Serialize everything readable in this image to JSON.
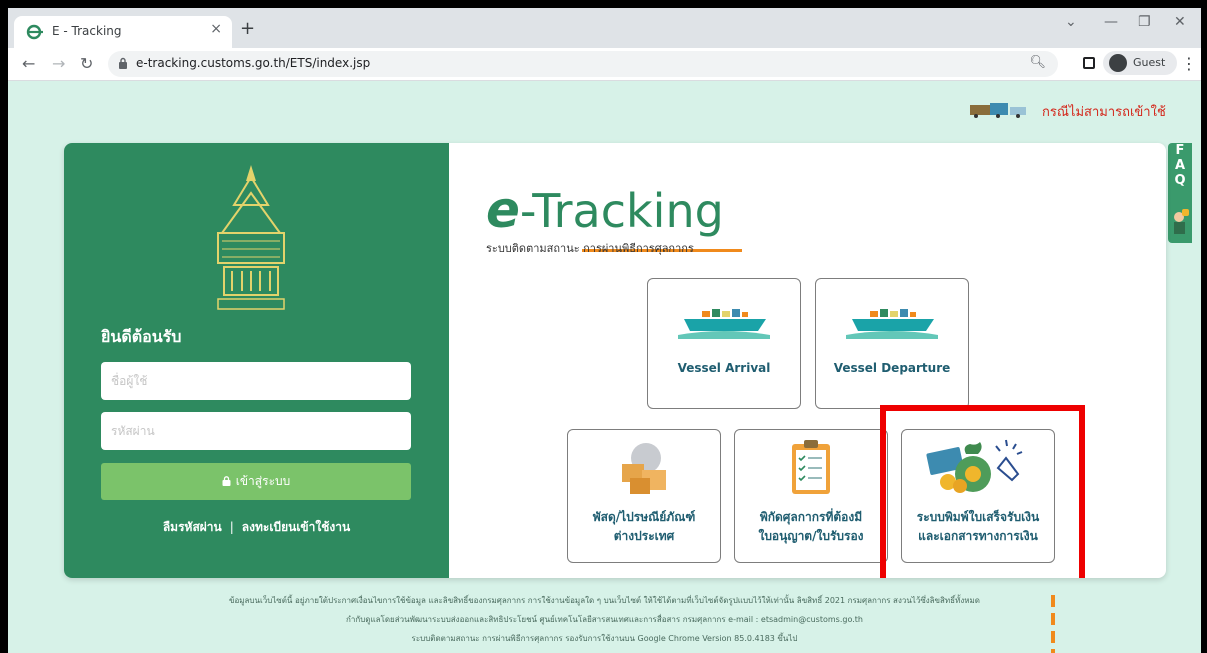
{
  "browser": {
    "tab_title": "E - Tracking",
    "tab_close": "×",
    "new_tab": "+",
    "url": "e-tracking.customs.go.th/ETS/index.jsp",
    "guest_label": "Guest"
  },
  "notice": {
    "text": "กรณีไม่สามารถเข้าใช้"
  },
  "faq": {
    "letters": [
      "F",
      "A",
      "Q"
    ]
  },
  "login": {
    "welcome": "ยินดีต้อนรับ",
    "username_placeholder": "ชื่อผู้ใช้",
    "password_placeholder": "รหัสผ่าน",
    "login_button": "เข้าสู่ระบบ",
    "forgot_password": "ลืมรหัสผ่าน",
    "separator": "|",
    "register": "ลงทะเบียนเข้าใช้งาน"
  },
  "brand": {
    "logo_e": "e",
    "logo_text": "-Tracking",
    "subtitle": "ระบบติดตามสถานะ การผ่านพิธีการศุลกากร"
  },
  "tiles": {
    "vessel_arrival": "Vessel Arrival",
    "vessel_departure": "Vessel Departure",
    "parcel_line1": "พัสดุ/ไปรษณีย์ภัณฑ์",
    "parcel_line2": "ต่างประเทศ",
    "tariff_line1": "พิกัดศุลกากรที่ต้องมี",
    "tariff_line2": "ใบอนุญาต/ใบรับรอง",
    "receipt_line1": "ระบบพิมพ์ใบเสร็จรับเงิน",
    "receipt_line2": "และเอกสารทางการเงิน"
  },
  "footer": {
    "line1": "ข้อมูลบนเว็บไซต์นี้ อยู่ภายใต้ประกาศเงื่อนไขการใช้ข้อมูล และลิขสิทธิ์ของกรมศุลกากร การใช้งานข้อมูลใด ๆ บนเว็บไซต์ ให้ใช้ได้ตามที่เว็บไซต์จัดรูปแบบไว้ให้เท่านั้น ลิขสิทธิ์ 2021 กรมศุลกากร สงวนไว้ซึ่งลิขสิทธิ์ทั้งหมด",
    "line2": "กำกับดูแลโดยส่วนพัฒนาระบบส่งออกและสิทธิประโยชน์ ศูนย์เทคโนโลยีสารสนเทศและการสื่อสาร กรมศุลกากร e-mail : etsadmin@customs.go.th",
    "line3_prefix": "ระบบติดตามสถานะ การผ่านพิธีการศุลกากร รองรับการใช้งานบน",
    "line3_highlight": "Google Chrome Version 85.0.4183 ขึ้นไป"
  },
  "colors": {
    "page_bg": "#d7f2e8",
    "panel_green": "#2e8a5f",
    "button_green": "#7bc36a",
    "highlight_red": "#ee0000"
  }
}
